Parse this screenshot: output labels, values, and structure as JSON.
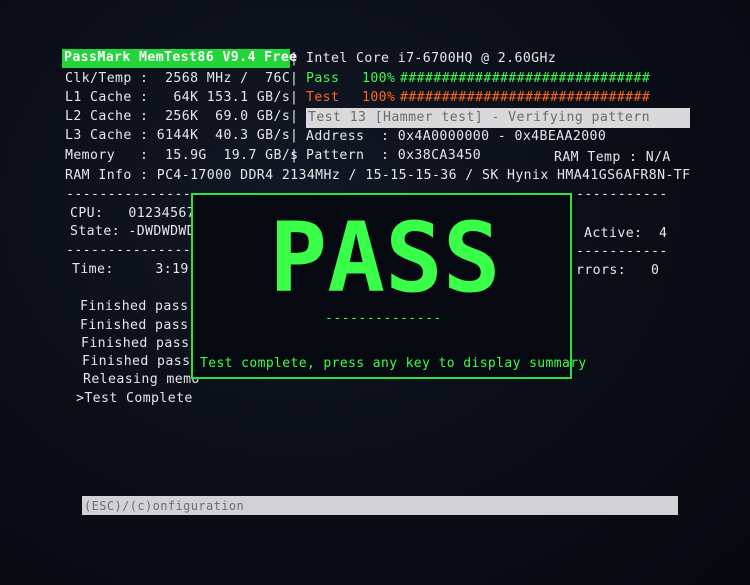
{
  "header": {
    "title": "PassMark MemTest86 V9.4 Free",
    "cpu_name": "Intel Core i7-6700HQ @ 2.60GHz"
  },
  "system": {
    "clk_temp": "Clk/Temp :  2568 MHz /  76C",
    "l1": "L1 Cache :   64K 153.1 GB/s",
    "l2": "L2 Cache :  256K  69.0 GB/s",
    "l3": "L3 Cache : 6144K  40.3 GB/s",
    "memory": "Memory   :  15.9G  19.7 GB/s",
    "ram_info": "RAM Info : PC4-17000 DDR4 2134MHz / 15-15-15-36 / SK Hynix HMA41GS6AFR8N-TF"
  },
  "progress": {
    "pass_label": "Pass",
    "pass_pct": "100%",
    "pass_bar": "##############################",
    "test_label": "Test",
    "test_pct": "100%",
    "test_bar": "##############################",
    "pass_fraction": 1.0,
    "test_fraction": 1.0
  },
  "test": {
    "current": "Test 13 [Hammer test] - Verifying pattern",
    "address": "Address  : 0x4A0000000 - 0x4BEAA2000",
    "pattern": "Pattern  : 0x38CA3450",
    "ram_temp": "RAM Temp : N/A"
  },
  "state": {
    "dashes_top": "----------------",
    "cpu": "CPU:   01234567",
    "state": "State: -DWDWDWD",
    "dashes_mid": "----------------",
    "time": "Time:     3:19:",
    "active": "Active:  4",
    "errors": "rrors:   0",
    "dashes_right_top": "-----------",
    "dashes_right_mid": "-----------"
  },
  "log": [
    "Finished pass",
    "Finished pass",
    "Finished pass",
    "Finished pass",
    "Releasing memo",
    ">Test Complete"
  ],
  "result": {
    "banner": "PASS",
    "dashes": "--------------",
    "message": "Test complete, press any key to display summary",
    "color": "#39ff48"
  },
  "statusbar": {
    "text": "(ESC)/(c)onfiguration"
  }
}
